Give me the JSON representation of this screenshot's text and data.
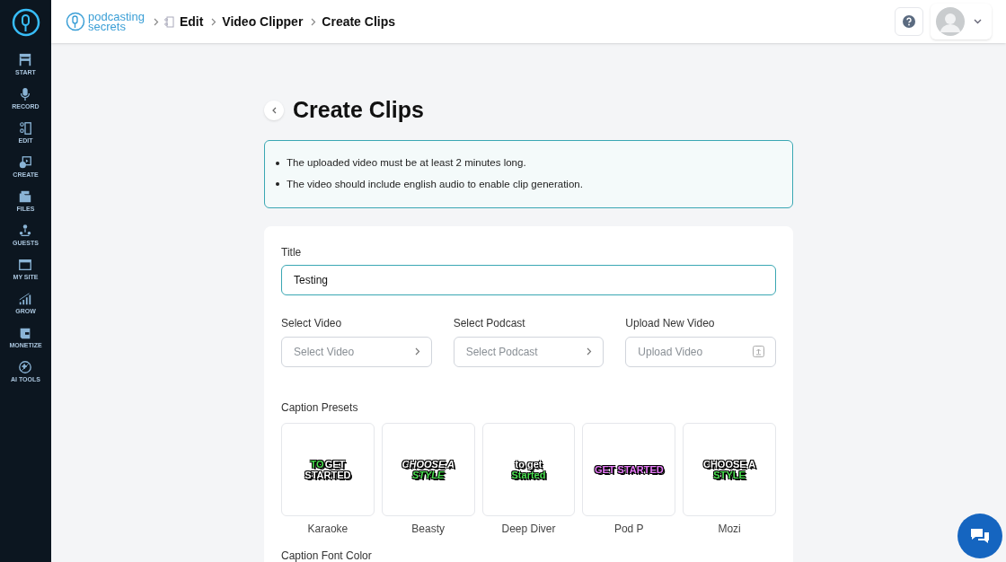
{
  "sidebar": {
    "items": [
      {
        "label": "START"
      },
      {
        "label": "RECORD"
      },
      {
        "label": "EDIT"
      },
      {
        "label": "CREATE"
      },
      {
        "label": "FILES"
      },
      {
        "label": "GUESTS"
      },
      {
        "label": "MY SITE"
      },
      {
        "label": "GROW"
      },
      {
        "label": "MONETIZE"
      },
      {
        "label": "AI TOOLS"
      }
    ]
  },
  "header": {
    "logo": [
      "podcasting",
      "secrets"
    ],
    "breadcrumbs": [
      "Edit",
      "Video Clipper",
      "Create Clips"
    ]
  },
  "page": {
    "title": "Create Clips",
    "notices": [
      "The uploaded video must be at least 2 minutes long.",
      "The video should include english audio to enable clip generation."
    ],
    "title_field": {
      "label": "Title",
      "value": "Testing"
    },
    "selectors": [
      {
        "label": "Select Video",
        "placeholder": "Select Video",
        "kind": "chevron"
      },
      {
        "label": "Select Podcast",
        "placeholder": "Select Podcast",
        "kind": "chevron"
      },
      {
        "label": "Upload New Video",
        "placeholder": "Upload Video",
        "kind": "upload"
      }
    ],
    "presets_label": "Caption Presets",
    "presets": [
      {
        "name": "Karaoke",
        "italic": false,
        "lines": [
          [
            {
              "text": "TO",
              "color": "#4ade50"
            },
            {
              "text": "GET",
              "color": "#ffffff"
            }
          ],
          [
            {
              "text": "STARTED",
              "color": "#ffffff"
            }
          ]
        ]
      },
      {
        "name": "Beasty",
        "italic": true,
        "lines": [
          [
            {
              "text": "CHOOSE A",
              "color": "#ffffff"
            }
          ],
          [
            {
              "text": "STYLE",
              "color": "#4ade50"
            }
          ]
        ]
      },
      {
        "name": "Deep Diver",
        "italic": false,
        "lines": [
          [
            {
              "text": "to get",
              "color": "#ffffff"
            }
          ],
          [
            {
              "text": "Started",
              "color": "#4ade50"
            }
          ]
        ]
      },
      {
        "name": "Pod P",
        "italic": false,
        "lines": [
          [
            {
              "text": "GET STARTED",
              "color": "#e879f9"
            }
          ]
        ]
      },
      {
        "name": "Mozi",
        "italic": false,
        "lines": [
          [
            {
              "text": "CHOOSE A",
              "color": "#ffffff"
            }
          ],
          [
            {
              "text": "STYLE",
              "color": "#4ade50"
            }
          ]
        ]
      }
    ],
    "font_color_label": "Caption Font Color"
  }
}
